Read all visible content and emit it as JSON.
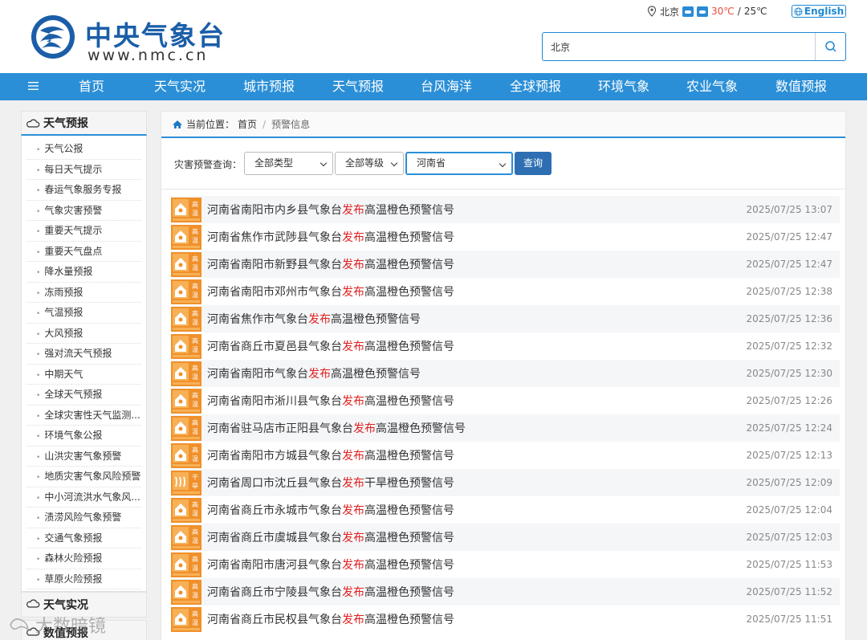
{
  "header": {
    "logo_cn": "中央气象台",
    "logo_url": "www.nmc.cn",
    "city": "北京",
    "temp_high": "30℃",
    "temp_sep": " / ",
    "temp_low": "25℃",
    "lang_label": "English",
    "search_value": "北京"
  },
  "nav": {
    "items": [
      "首页",
      "天气实况",
      "城市预报",
      "天气预报",
      "台风海洋",
      "全球预报",
      "环境气象",
      "农业气象",
      "数值预报"
    ]
  },
  "sidebar": {
    "title": "天气预报",
    "items": [
      "天气公报",
      "每日天气提示",
      "春运气象服务专报",
      "气象灾害预警",
      "重要天气提示",
      "重要天气盘点",
      "降水量预报",
      "冻雨预报",
      "气温预报",
      "大风预报",
      "强对流天气预报",
      "中期天气",
      "全球天气预报",
      "全球灾害性天气监测...",
      "环境气象公报",
      "山洪灾害气象预警",
      "地质灾害气象风险预警",
      "中小河流洪水气象风...",
      "渍涝风险气象预警",
      "交通气象预报",
      "森林火险预报",
      "草原火险预报"
    ],
    "section2": "天气实况",
    "section3": "数值预报"
  },
  "breadcrumb": {
    "label": "当前位置：",
    "home": "首页",
    "sep": "/",
    "current": "预警信息"
  },
  "filter": {
    "label": "灾害预警查询：",
    "type": "全部类型",
    "level": "全部等级",
    "province": "河南省",
    "query_label": "查询"
  },
  "warnings": [
    {
      "pre": "河南省南阳市内乡县气象台",
      "pub": "发布",
      "post": "高温橙色预警信号",
      "date": "2025/07/25 13:07",
      "sig": [
        "高",
        "温"
      ]
    },
    {
      "pre": "河南省焦作市武陟县气象台",
      "pub": "发布",
      "post": "高温橙色预警信号",
      "date": "2025/07/25 12:47",
      "sig": [
        "高",
        "温"
      ]
    },
    {
      "pre": "河南省南阳市新野县气象台",
      "pub": "发布",
      "post": "高温橙色预警信号",
      "date": "2025/07/25 12:47",
      "sig": [
        "高",
        "温"
      ]
    },
    {
      "pre": "河南省南阳市邓州市气象台",
      "pub": "发布",
      "post": "高温橙色预警信号",
      "date": "2025/07/25 12:38",
      "sig": [
        "高",
        "温"
      ]
    },
    {
      "pre": "河南省焦作市气象台",
      "pub": "发布",
      "post": "高温橙色预警信号",
      "date": "2025/07/25 12:36",
      "sig": [
        "高",
        "温"
      ]
    },
    {
      "pre": "河南省商丘市夏邑县气象台",
      "pub": "发布",
      "post": "高温橙色预警信号",
      "date": "2025/07/25 12:32",
      "sig": [
        "高",
        "温"
      ]
    },
    {
      "pre": "河南省南阳市气象台",
      "pub": "发布",
      "post": "高温橙色预警信号",
      "date": "2025/07/25 12:30",
      "sig": [
        "高",
        "温"
      ]
    },
    {
      "pre": "河南省南阳市淅川县气象台",
      "pub": "发布",
      "post": "高温橙色预警信号",
      "date": "2025/07/25 12:26",
      "sig": [
        "高",
        "温"
      ]
    },
    {
      "pre": "河南省驻马店市正阳县气象台",
      "pub": "发布",
      "post": "高温橙色预警信号",
      "date": "2025/07/25 12:24",
      "sig": [
        "高",
        "温"
      ]
    },
    {
      "pre": "河南省南阳市方城县气象台",
      "pub": "发布",
      "post": "高温橙色预警信号",
      "date": "2025/07/25 12:13",
      "sig": [
        "高",
        "温"
      ]
    },
    {
      "pre": "河南省周口市沈丘县气象台",
      "pub": "发布",
      "post": "干旱橙色预警信号",
      "date": "2025/07/25 12:09",
      "sig": [
        "干",
        "旱"
      ]
    },
    {
      "pre": "河南省商丘市永城市气象台",
      "pub": "发布",
      "post": "高温橙色预警信号",
      "date": "2025/07/25 12:04",
      "sig": [
        "高",
        "温"
      ]
    },
    {
      "pre": "河南省商丘市虞城县气象台",
      "pub": "发布",
      "post": "高温橙色预警信号",
      "date": "2025/07/25 12:03",
      "sig": [
        "高",
        "温"
      ]
    },
    {
      "pre": "河南省南阳市唐河县气象台",
      "pub": "发布",
      "post": "高温橙色预警信号",
      "date": "2025/07/25 11:53",
      "sig": [
        "高",
        "温"
      ]
    },
    {
      "pre": "河南省商丘市宁陵县气象台",
      "pub": "发布",
      "post": "高温橙色预警信号",
      "date": "2025/07/25 11:52",
      "sig": [
        "高",
        "温"
      ]
    },
    {
      "pre": "河南省商丘市民权县气象台",
      "pub": "发布",
      "post": "高温橙色预警信号",
      "date": "2025/07/25 11:51",
      "sig": [
        "高",
        "温"
      ]
    }
  ],
  "watermark": "大数暗镜",
  "colors": {
    "nav": "#2b8fd7",
    "signal_orange": "#f0902a",
    "publish_red": "#e02020"
  }
}
